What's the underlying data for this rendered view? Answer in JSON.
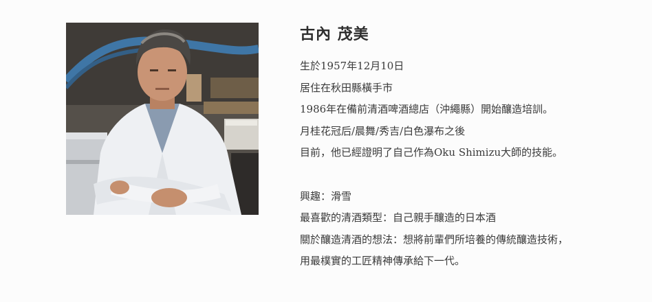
{
  "profile": {
    "name": "古內 茂美",
    "bio": [
      "生於1957年12月10日",
      "居住在秋田縣橫手市",
      "1986年在備前清酒啤酒總店（沖繩縣）開始釀造培訓。",
      "月桂花冠后/晨舞/秀吉/白色瀑布之後",
      "目前，他已經證明了自己作為Oku Shimizu大師的技能。"
    ],
    "details": [
      "興趣：滑雪",
      "最喜歡的清酒類型：自己親手釀造的日本酒",
      "關於釀造清酒的想法：想將前輩們所培養的傳統釀造技術，",
      "用最樸實的工匠精神傳承給下一代。"
    ]
  },
  "colors": {
    "background": "#fcfcfc",
    "text": "#3a3a3a",
    "coat": "#eef0f3",
    "shirt": "#8a9bb0"
  }
}
